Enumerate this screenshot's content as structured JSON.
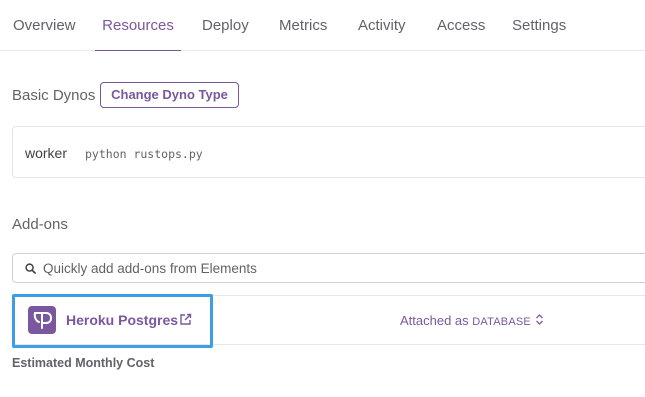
{
  "tabs": [
    {
      "label": "Overview"
    },
    {
      "label": "Resources"
    },
    {
      "label": "Deploy"
    },
    {
      "label": "Metrics"
    },
    {
      "label": "Activity"
    },
    {
      "label": "Access"
    },
    {
      "label": "Settings"
    }
  ],
  "active_tab": "Resources",
  "dynos": {
    "title": "Basic Dynos",
    "change_button": "Change Dyno Type",
    "items": [
      {
        "type": "worker",
        "command": "python rustops.py"
      }
    ]
  },
  "addons": {
    "title": "Add-ons",
    "search_placeholder": "Quickly add add-ons from Elements",
    "items": [
      {
        "name": "Heroku Postgres",
        "attached_prefix": "Attached as",
        "attached_name": "DATABASE",
        "icon": "postgres-elephant-icon"
      }
    ],
    "estimated_cost_label": "Estimated Monthly Cost"
  },
  "colors": {
    "accent": "#79589f",
    "highlight": "#3d9ee6",
    "text": "#3f3f44",
    "muted": "#62626b",
    "border": "#e7e7ec"
  }
}
